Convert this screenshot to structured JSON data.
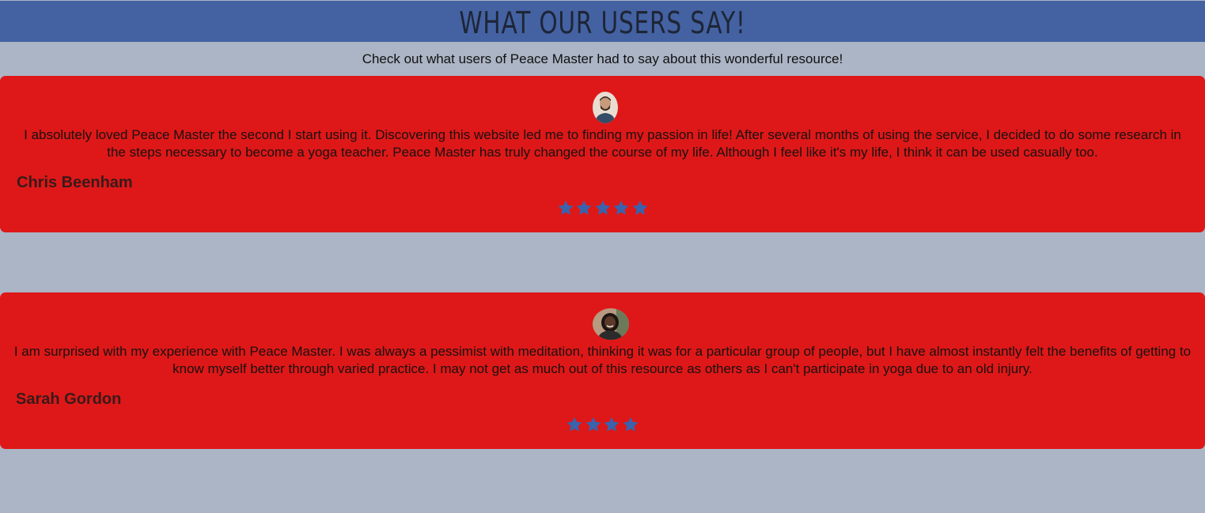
{
  "header": {
    "title": "WHAT OUR USERS SAY!"
  },
  "intro": {
    "text": "Check out what users of Peace Master had to say about this wonderful resource!"
  },
  "testimonials": [
    {
      "quote": "I absolutely loved Peace Master the second I start using it. Discovering this website led me to finding my passion in life! After several months of using the service, I decided to do some research in the steps necessary to become a yoga teacher. Peace Master has truly changed the course of my life. Although I feel like it's my life, I think it can be used casually too.",
      "name": "Chris Beenham",
      "rating": 5,
      "avatar_icon": "user-avatar-male"
    },
    {
      "quote": "I am surprised with my experience with Peace Master. I was always a pessimist with meditation, thinking it was for a particular group of people, but I have almost instantly felt the benefits of getting to know myself better through varied practice. I may not get as much out of this resource as others as I can't participate in yoga due to an old injury.",
      "name": "Sarah Gordon",
      "rating": 4,
      "avatar_icon": "user-avatar-female"
    }
  ],
  "colors": {
    "page_background": "#abb5c5",
    "header_background": "#4462a2",
    "card_background": "#de1818",
    "star": "#3a62ad"
  }
}
